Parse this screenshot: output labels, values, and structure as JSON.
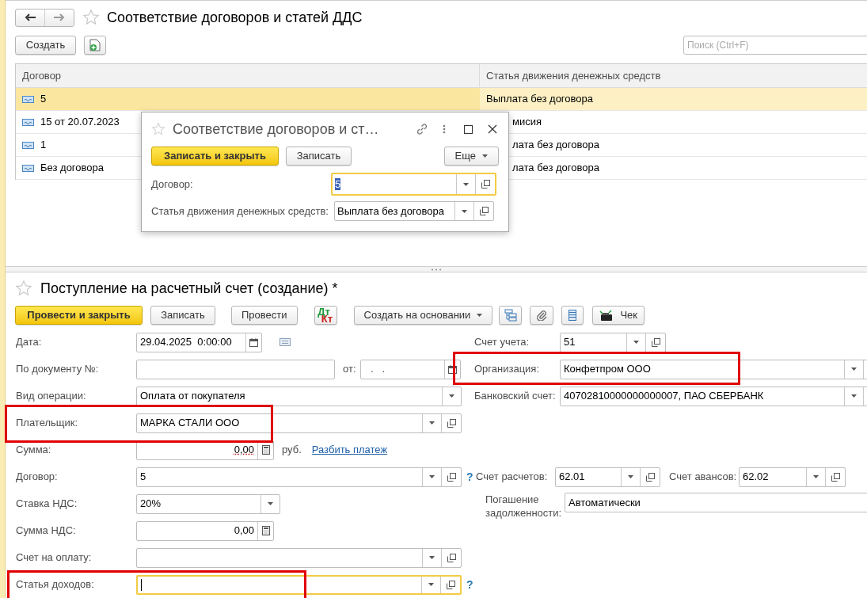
{
  "list_form": {
    "title": "Соответствие договоров и статей ДДС",
    "create_button": "Создать",
    "search": {
      "placeholder": "Поиск (Ctrl+F)"
    },
    "table": {
      "columns": [
        "Договор",
        "Статья движения денежных средств"
      ],
      "rows": [
        {
          "contract": "5",
          "item": "Выплата без договора",
          "selected": true,
          "covered": false
        },
        {
          "contract": "15 от 20.07.2023",
          "item": "мисия",
          "selected": false,
          "covered": true
        },
        {
          "contract": "1",
          "item": "лата без договора",
          "selected": false,
          "covered": true
        },
        {
          "contract": "Без договора",
          "item": "лата без договора",
          "selected": false,
          "covered": true
        }
      ]
    }
  },
  "dialog": {
    "title": "Соответствие договоров и ст…",
    "buttons": [
      {
        "label": "Записать и закрыть",
        "kind": "primary"
      },
      {
        "label": "Записать",
        "kind": "default"
      }
    ],
    "more_button": "Еще",
    "fields": [
      {
        "label": "Договор:",
        "value": "5",
        "focused": true,
        "text_selected": true
      },
      {
        "label": "Статья движения денежных средств:",
        "value": "Выплата без договора",
        "focused": false,
        "text_selected": false
      }
    ]
  },
  "document": {
    "title": "Поступление на расчетный счет (создание) *",
    "toolbar": [
      {
        "kind": "primary",
        "label": "Провести и закрыть"
      },
      {
        "kind": "button",
        "label": "Записать"
      },
      {
        "kind": "button",
        "label": "Провести"
      },
      {
        "kind": "dtkt",
        "top": "Дт",
        "bottom": "Кт"
      },
      {
        "kind": "menu",
        "label": "Создать на основании"
      },
      {
        "kind": "hierarchy"
      },
      {
        "kind": "clip"
      },
      {
        "kind": "list"
      },
      {
        "kind": "receipt",
        "label": "Чек"
      }
    ],
    "rows": [
      {
        "left": {
          "kind": "date",
          "label": "Дата:",
          "value": "29.04.2025  0:00:00"
        },
        "right": {
          "kind": "account",
          "label": "Счет учета:",
          "value": "51",
          "highlighted": false
        }
      },
      {
        "left": {
          "kind": "docnum",
          "label": "По документу №:",
          "from_label": "от:",
          "date_value": ".   ."
        },
        "right": {
          "kind": "wide",
          "label": "Организация:",
          "value": "Конфетпром ООО",
          "highlighted": true
        }
      },
      {
        "left": {
          "kind": "select",
          "label": "Вид операции:",
          "value": "Оплата от покупателя"
        },
        "right": {
          "kind": "wide",
          "label": "Банковский счет:",
          "value": "40702810000000000007, ПАО СБЕРБАНК",
          "highlighted": false
        }
      },
      {
        "left": {
          "kind": "ref",
          "label": "Плательщик:",
          "value": "МАРКА СТАЛИ ООО",
          "highlighted": true,
          "focused": false
        }
      },
      {
        "left": {
          "kind": "amount",
          "label": "Сумма:",
          "value": "0,00",
          "currency": "руб.",
          "link": "Разбить платеж",
          "unfilled": true
        }
      },
      {
        "left": {
          "kind": "ref",
          "label": "Договор:",
          "value": "5",
          "highlighted": false,
          "focused": false,
          "help": "?"
        },
        "right": {
          "kind": "pair",
          "label": "Счет расчетов:",
          "value": "62.01",
          "label2": "Счет авансов:",
          "value2": "62.02"
        }
      },
      {
        "left": {
          "kind": "rate",
          "label": "Ставка НДС:",
          "value": "20%"
        },
        "right": {
          "kind": "text",
          "label": "Погашение задолженности:",
          "value": "Автоматически"
        }
      },
      {
        "left": {
          "kind": "amount",
          "label": "Сумма НДС:",
          "value": "0,00",
          "unfilled": false
        }
      },
      {
        "left": {
          "kind": "ref",
          "label": "Счет на оплату:",
          "highlighted": false,
          "focused": false
        }
      },
      {
        "left": {
          "kind": "ref",
          "label": "Статья доходов:",
          "highlighted": true,
          "focused": true,
          "help": "?"
        }
      }
    ]
  }
}
